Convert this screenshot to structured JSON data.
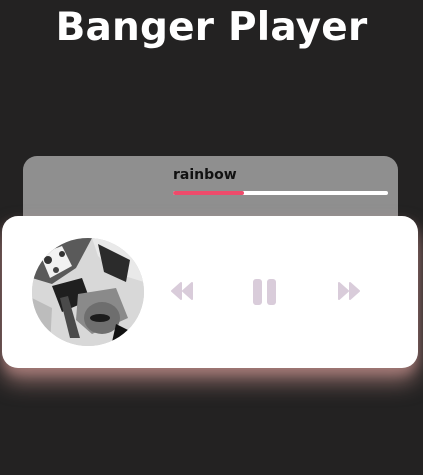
{
  "app": {
    "title": "Banger Player"
  },
  "track": {
    "title": "rainbow",
    "progress_percent": 33
  },
  "controls": {
    "prev_icon": "rewind-icon",
    "play_icon": "pause-icon",
    "next_icon": "fast-forward-icon"
  },
  "colors": {
    "background": "#232222",
    "info_panel": "#8f8f8f",
    "accent": "#ee4b6b",
    "control_icon": "#d9ccda",
    "card": "#ffffff"
  }
}
